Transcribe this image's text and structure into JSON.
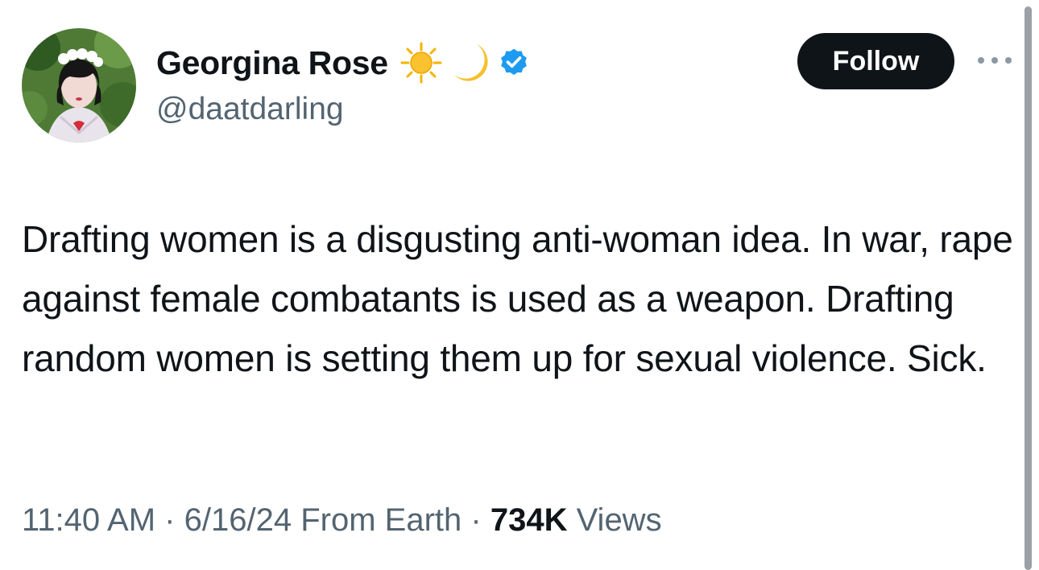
{
  "author": {
    "display_name": "Georgina Rose",
    "handle": "@daatdarling",
    "name_emojis": [
      "sun-emoji",
      "crescent-moon-emoji"
    ],
    "verified": true,
    "verified_color": "#1d9bf0"
  },
  "actions": {
    "follow_label": "Follow",
    "more_icon": "more-dots-icon"
  },
  "tweet": {
    "text": "Drafting women is a disgusting anti-woman idea. In war, rape against female combatants is used as a weapon. Drafting random women is setting them up for sexual violence. Sick."
  },
  "meta": {
    "time": "11:40 AM",
    "separator": "·",
    "date": "6/16/24",
    "source": "From Earth",
    "views_count": "734K",
    "views_label": "Views"
  },
  "colors": {
    "text_primary": "#0f1419",
    "text_secondary": "#536471",
    "follow_bg": "#0f1419",
    "follow_text": "#ffffff"
  }
}
